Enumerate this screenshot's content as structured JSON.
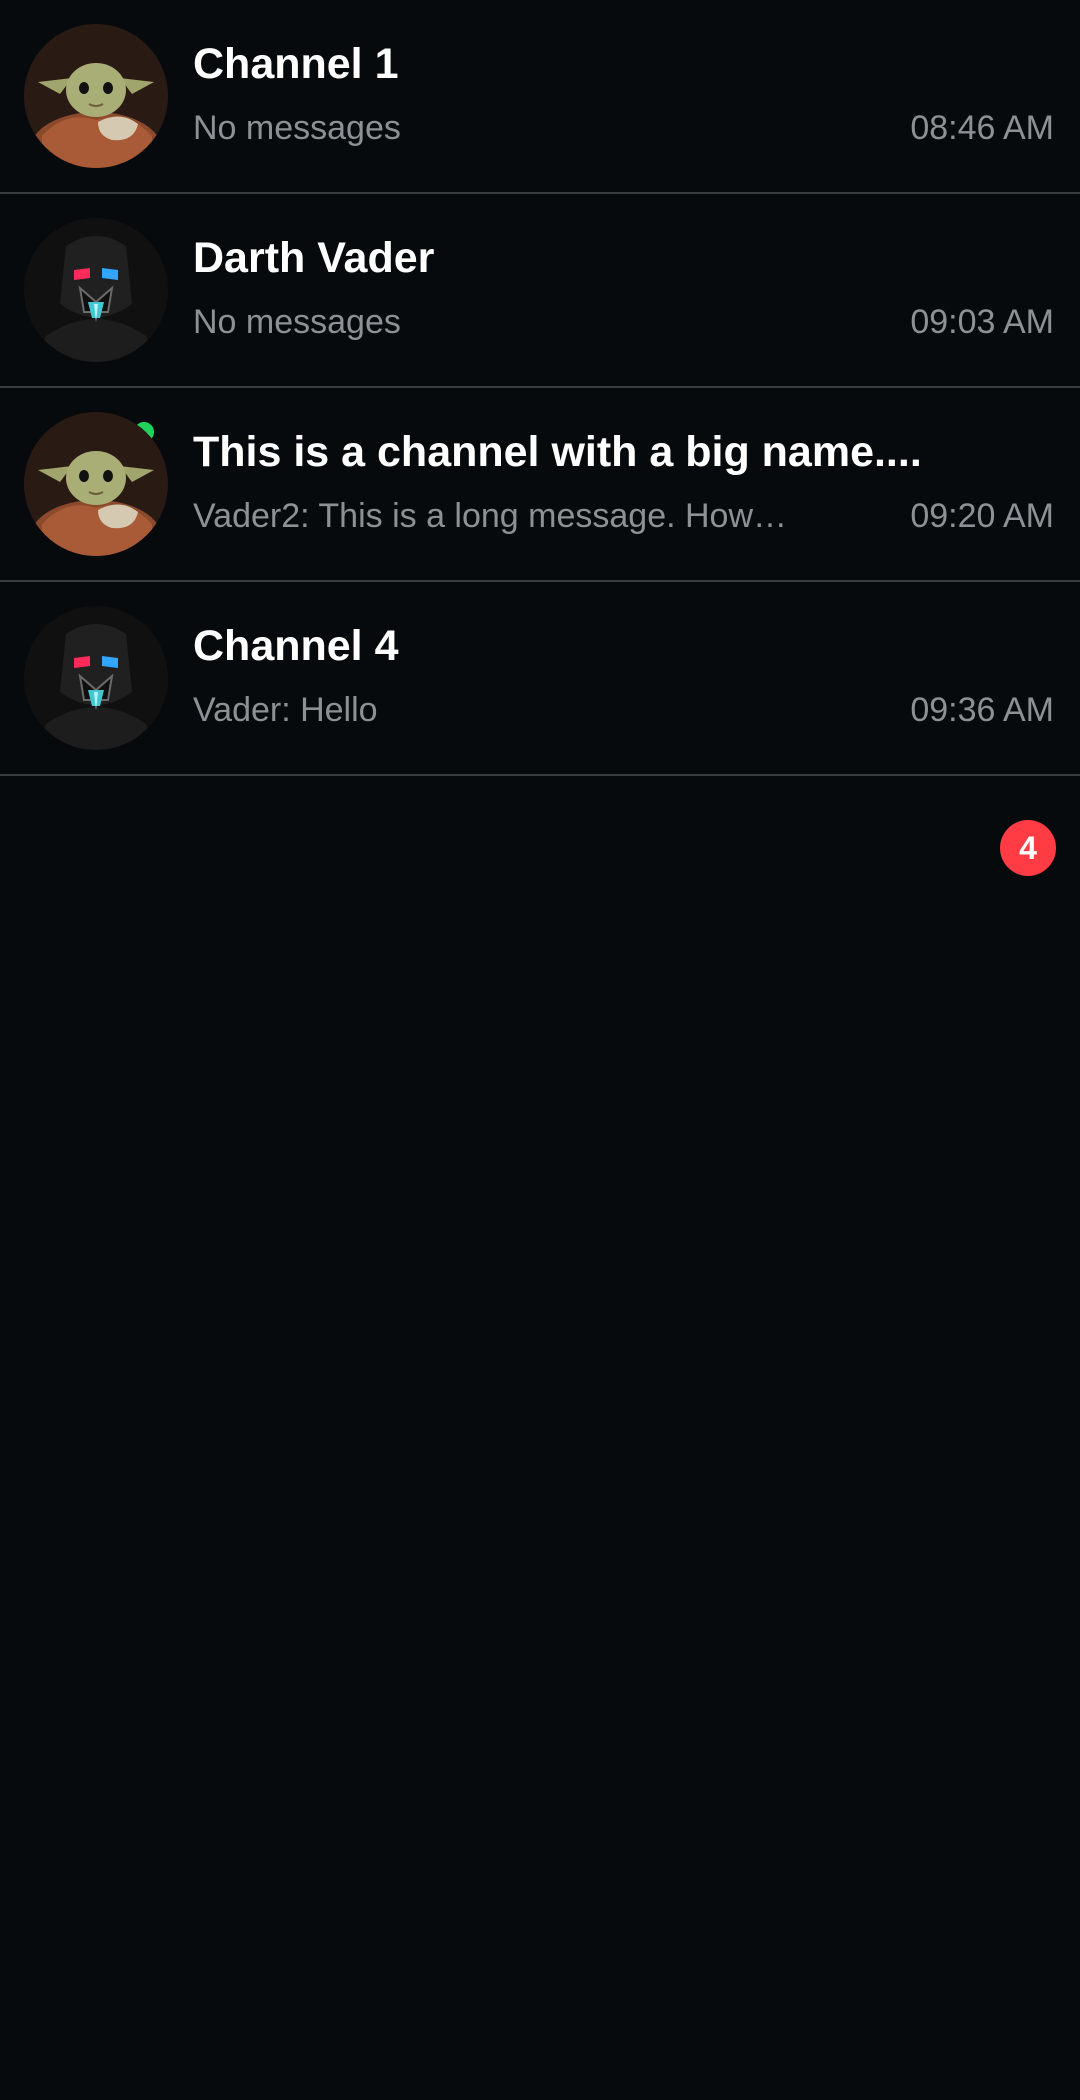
{
  "channels": [
    {
      "title": "Channel 1",
      "preview": "No messages",
      "time": "08:46 AM",
      "avatar_icon": "baby-yoda-avatar",
      "online": false
    },
    {
      "title": "Darth Vader",
      "preview": "No messages",
      "time": "09:03 AM",
      "avatar_icon": "darth-vader-avatar",
      "online": true
    },
    {
      "title": "This is a channel with a big name....",
      "preview": "Vader2: This is a long message. How…",
      "time": "09:20 AM",
      "avatar_icon": "baby-yoda-avatar",
      "unread_count": "4"
    },
    {
      "title": "Channel 4",
      "preview": "Vader: Hello",
      "time": "09:36 AM",
      "avatar_icon": "darth-vader-avatar",
      "online": false
    }
  ],
  "colors": {
    "background": "#070a0d",
    "divider": "#3a3d40",
    "secondary_text": "#8d9196",
    "online": "#20d15b",
    "unread_badge": "#ff3b43"
  }
}
